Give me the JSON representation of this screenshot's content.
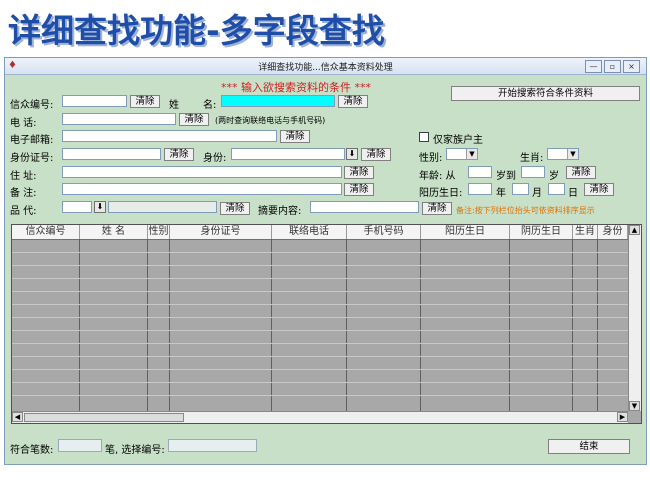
{
  "slide_title": "详细查找功能-多字段查找",
  "window": {
    "title": "详细查找功能...信众基本资料处理",
    "controls": [
      "—",
      "▫",
      "×"
    ]
  },
  "form": {
    "prompt": "*** 输入欲搜索资料的条件 ***",
    "start_search_label": "开始搜索符合条件资料",
    "clear_label": "清除",
    "believer_id_label": "信众编号:",
    "name_label_a": "姓",
    "name_label_b": "名:",
    "phone_label": "电      话:",
    "phone_hint": "(两时查询联络电话与手机号码)",
    "email_label": "电子邮箱:",
    "only_household_label": "仅家族户主",
    "id_card_label": "身份证号:",
    "identity_label": "身份:",
    "gender_label": "性别:",
    "zodiac_label": "生肖:",
    "address_label": "住      址:",
    "age_label": "年龄: 从",
    "age_to_label": "岁到",
    "age_unit_label": "岁",
    "note_label": "备      注:",
    "birth_label": "阳历生日:",
    "year_label": "年",
    "month_label": "月",
    "day_label": "日",
    "generation_label": "品      代:",
    "summary_label": "摘要内容:",
    "sort_note": "备注:按下列栏位抬头可依资料排序显示"
  },
  "table": {
    "columns": [
      "信众编号",
      "姓    名",
      "性别",
      "身份证号",
      "联络电话",
      "手机号码",
      "阳历生日",
      "阴历生日",
      "生肖",
      "身份"
    ]
  },
  "footer": {
    "match_count_label": "符合笔数:",
    "selected_label": "笔, 选择编号:",
    "close_label": "结束"
  }
}
